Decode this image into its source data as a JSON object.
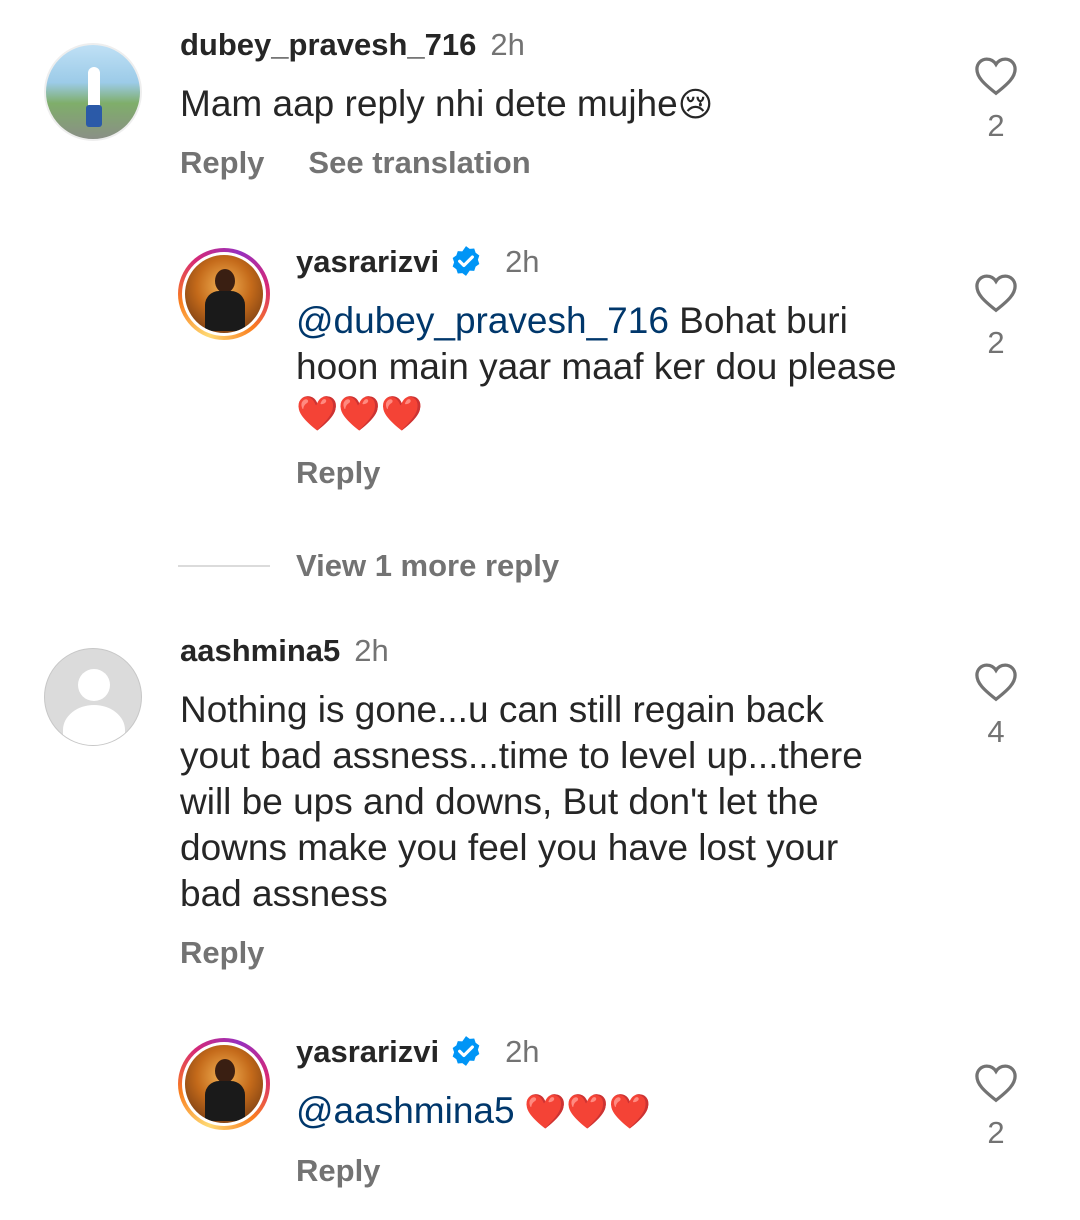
{
  "comments": [
    {
      "username": "dubey_pravesh_716",
      "time": "2h",
      "text": "Mam aap reply nhi dete mujhe",
      "emoji": "😢",
      "reply_label": "Reply",
      "translate_label": "See translation",
      "likes": "2"
    },
    {
      "username": "yasrarizvi",
      "time": "2h",
      "mention": "@dubey_pravesh_716",
      "text_line1": " Bohat buri",
      "text_line2": "hoon main yaar maaf ker dou please",
      "text_line3": "❤️❤️❤️",
      "reply_label": "Reply",
      "likes": "2"
    },
    {
      "view_more": "View 1 more reply"
    },
    {
      "username": "aashmina5",
      "time": "2h",
      "lines": [
        "Nothing is gone...u can still regain back",
        "yout bad assness...time to level up...there",
        "will be ups and downs, But don't let the",
        "downs make you feel you have lost your",
        "bad assness"
      ],
      "reply_label": "Reply",
      "likes": "4"
    },
    {
      "username": "yasrarizvi",
      "time": "2h",
      "mention": "@aashmina5",
      "text": " ❤️❤️❤️",
      "reply_label": "Reply",
      "likes": "2"
    }
  ],
  "colors": {
    "verified": "#0095f6",
    "mention": "#00376b",
    "muted": "#737373"
  },
  "icons": {
    "like": "heart-outline-icon",
    "verified": "verified-badge-icon"
  }
}
